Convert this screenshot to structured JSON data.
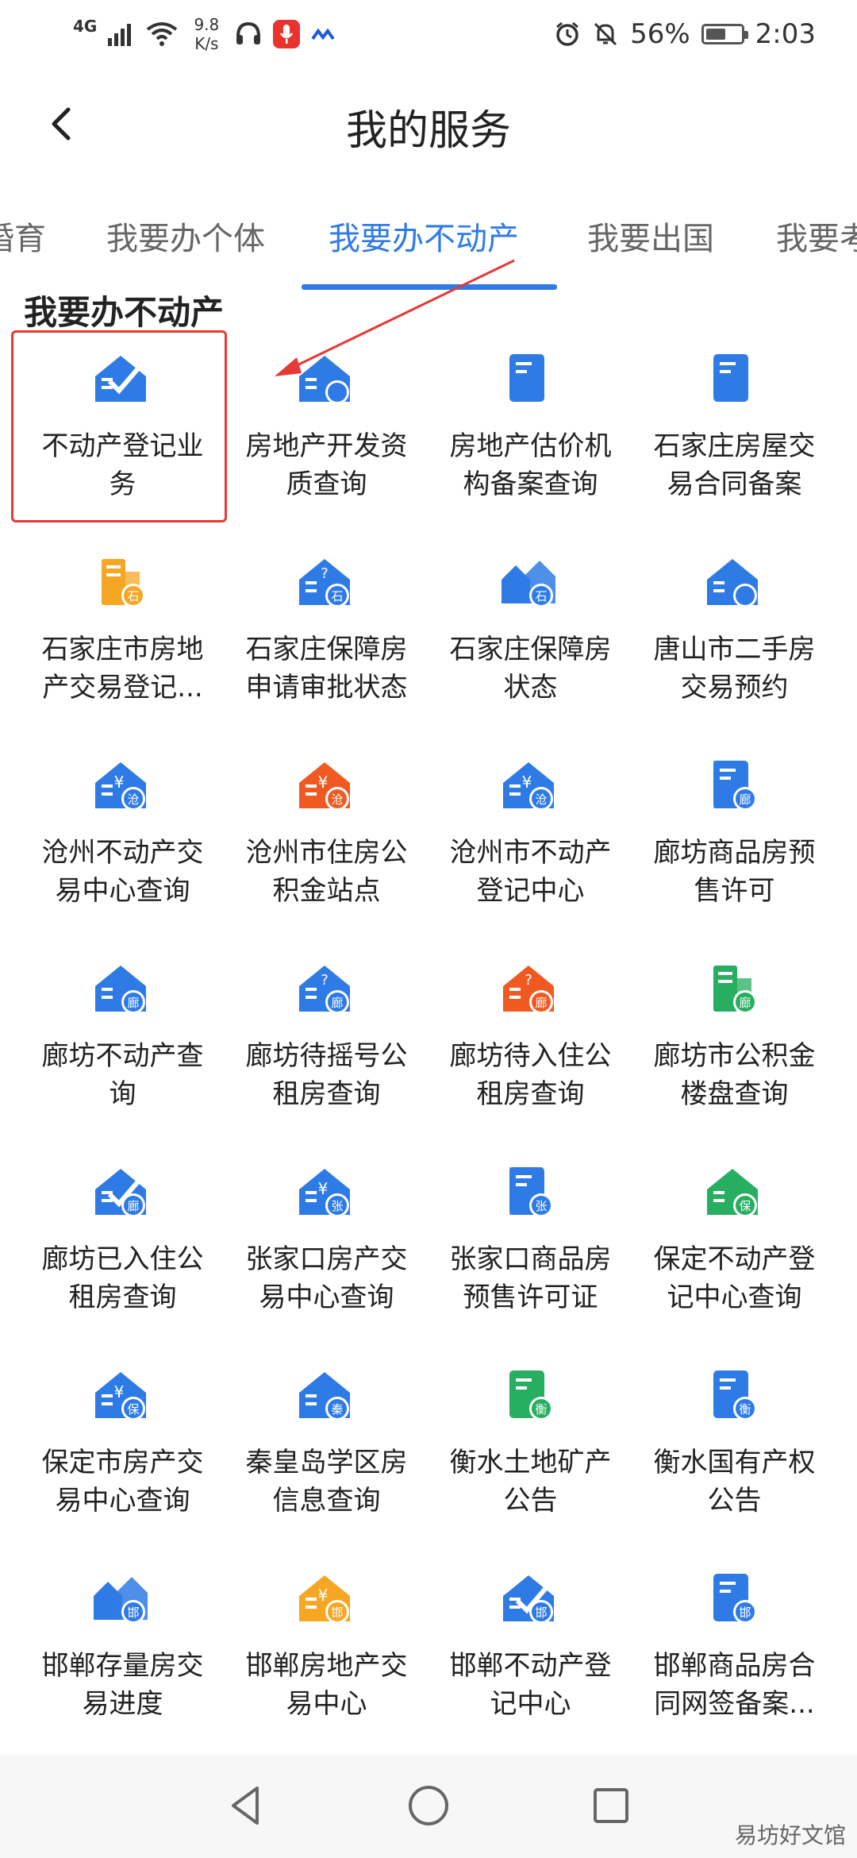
{
  "status_bar": {
    "network": "4G",
    "speed_value": "9.8",
    "speed_unit": "K/s",
    "battery": "56%",
    "battery_level": 0.56,
    "time": "2:03"
  },
  "header": {
    "title": "我的服务",
    "back_icon": "chevron-left-icon"
  },
  "tabs": [
    {
      "label": "婚育",
      "active": false
    },
    {
      "label": "我要办个体",
      "active": false
    },
    {
      "label": "我要办不动产",
      "active": true
    },
    {
      "label": "我要出国",
      "active": false
    },
    {
      "label": "我要考",
      "active": false
    }
  ],
  "section_title": "我要办不动产",
  "services": [
    {
      "label": "不动产登记业务",
      "icon": "house-check-icon",
      "color": "#2f7be6"
    },
    {
      "label": "房地产开发资质查询",
      "icon": "house-search-icon",
      "color": "#2f7be6"
    },
    {
      "label": "房地产估价机构备案查询",
      "icon": "doc-house-icon",
      "color": "#2f7be6"
    },
    {
      "label": "石家庄房屋交易合同备案",
      "icon": "doc-person-icon",
      "color": "#2f7be6"
    },
    {
      "label": "石家庄市房地产交易登记...",
      "icon": "building-shi-icon",
      "color": "#f5a623"
    },
    {
      "label": "石家庄保障房申请审批状态",
      "icon": "house-question-shi-icon",
      "color": "#2f7be6"
    },
    {
      "label": "石家庄保障房状态",
      "icon": "houses-shi-icon",
      "color": "#2f7be6"
    },
    {
      "label": "唐山市二手房交易预约",
      "icon": "house-clock-icon",
      "color": "#2f7be6"
    },
    {
      "label": "沧州不动产交易中心查询",
      "icon": "house-yen-cang-icon",
      "color": "#2f7be6"
    },
    {
      "label": "沧州市住房公积金站点",
      "icon": "house-yen-cang-icon",
      "color": "#f05a22"
    },
    {
      "label": "沧州市不动产登记中心",
      "icon": "house-yen-cang-icon",
      "color": "#2f7be6"
    },
    {
      "label": "廊坊商品房预售许可",
      "icon": "book-lang-icon",
      "color": "#2f7be6"
    },
    {
      "label": "廊坊不动产查询",
      "icon": "house-search-lang-icon",
      "color": "#2f7be6"
    },
    {
      "label": "廊坊待摇号公租房查询",
      "icon": "house-question-lang-icon",
      "color": "#2f7be6"
    },
    {
      "label": "廊坊待入住公租房查询",
      "icon": "house-question-lang-icon",
      "color": "#f05a22"
    },
    {
      "label": "廊坊市公积金楼盘查询",
      "icon": "building-lang-icon",
      "color": "#27ae60"
    },
    {
      "label": "廊坊已入住公租房查询",
      "icon": "house-check-lang-icon",
      "color": "#2f7be6"
    },
    {
      "label": "张家口房产交易中心查询",
      "icon": "house-yen-zhang-icon",
      "color": "#2f7be6"
    },
    {
      "label": "张家口商品房预售许可证",
      "icon": "book-zhang-icon",
      "color": "#2f7be6"
    },
    {
      "label": "保定不动产登记中心查询",
      "icon": "house-bao-icon",
      "color": "#27ae60"
    },
    {
      "label": "保定市房产交易中心查询",
      "icon": "house-yen-bao-icon",
      "color": "#2f7be6"
    },
    {
      "label": "秦皇岛学区房信息查询",
      "icon": "house-book-qin-icon",
      "color": "#2f7be6"
    },
    {
      "label": "衡水土地矿产公告",
      "icon": "doc-heng-icon",
      "color": "#27ae60"
    },
    {
      "label": "衡水国有产权公告",
      "icon": "doc-heng-icon",
      "color": "#2f7be6"
    },
    {
      "label": "邯郸存量房交易进度",
      "icon": "houses-han-icon",
      "color": "#2f7be6"
    },
    {
      "label": "邯郸房地产交易中心",
      "icon": "house-yen-han-icon",
      "color": "#f5a623"
    },
    {
      "label": "邯郸不动产登记中心",
      "icon": "house-check-han-icon",
      "color": "#2f7be6"
    },
    {
      "label": "邯郸商品房合同网签备案...",
      "icon": "doc-han-icon",
      "color": "#2f7be6"
    }
  ],
  "icon_badges": {
    "shi": "石",
    "cang": "沧",
    "lang": "廊",
    "zhang": "张",
    "bao": "保",
    "qin": "秦",
    "heng": "衡",
    "han": "邯",
    "yen": "¥",
    "question": "?"
  },
  "watermark": "易坊好文馆"
}
